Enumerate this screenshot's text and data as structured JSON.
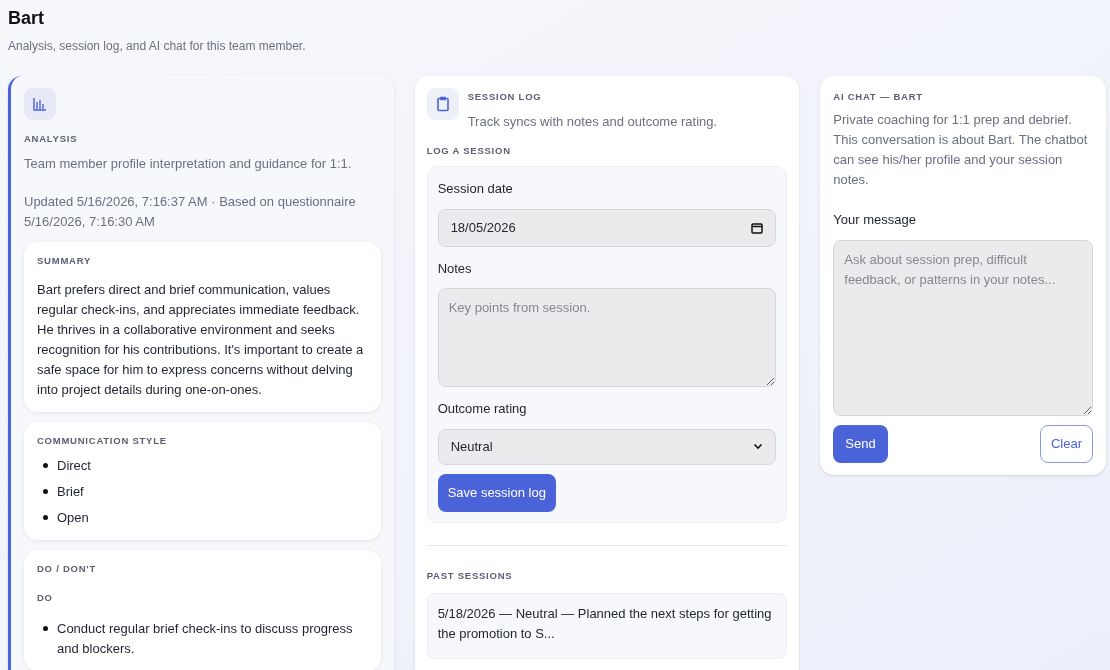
{
  "header": {
    "title": "Bart",
    "subtitle": "Analysis, session log, and AI chat for this team member."
  },
  "analysis": {
    "heading": "ANALYSIS",
    "description": "Team member profile interpretation and guidance for 1:1.",
    "updated": "Updated 5/16/2026, 7:16:37 AM · Based on questionnaire 5/16/2026, 7:16:30 AM",
    "sections": [
      {
        "kind": "paragraph",
        "heading": "SUMMARY",
        "text": "Bart prefers direct and brief communication, values regular check-ins, and appreciates immediate feedback. He thrives in a collaborative environment and seeks recognition for his contributions. It's important to create a safe space for him to express concerns without delving into project details during one-on-ones."
      },
      {
        "kind": "list",
        "heading": "COMMUNICATION STYLE",
        "items": [
          "Direct",
          "Brief",
          "Open"
        ]
      },
      {
        "kind": "dodont",
        "heading": "DO / DON'T",
        "subheading": "DO",
        "items": [
          "Conduct regular brief check-ins to discuss progress and blockers."
        ]
      }
    ]
  },
  "session_log": {
    "heading": "SESSION LOG",
    "description": "Track syncs with notes and outcome rating.",
    "form_heading": "LOG A SESSION",
    "date_label": "Session date",
    "date_value": "18/05/2026",
    "notes_label": "Notes",
    "notes_placeholder": "Key points from session.",
    "rating_label": "Outcome rating",
    "rating_value": "Neutral",
    "save_button": "Save session log",
    "past_heading": "PAST SESSIONS",
    "past_sessions": [
      "5/18/2026 — Neutral — Planned the next steps for getting the promotion to S..."
    ]
  },
  "chat": {
    "heading": "AI CHAT — BART",
    "description": "Private coaching for 1:1 prep and debrief. This conversation is about Bart. The chatbot can see his/her profile and your session notes.",
    "message_label": "Your message",
    "message_placeholder": "Ask about session prep, difficult feedback, or patterns in your notes...",
    "send_button": "Send",
    "clear_button": "Clear"
  }
}
